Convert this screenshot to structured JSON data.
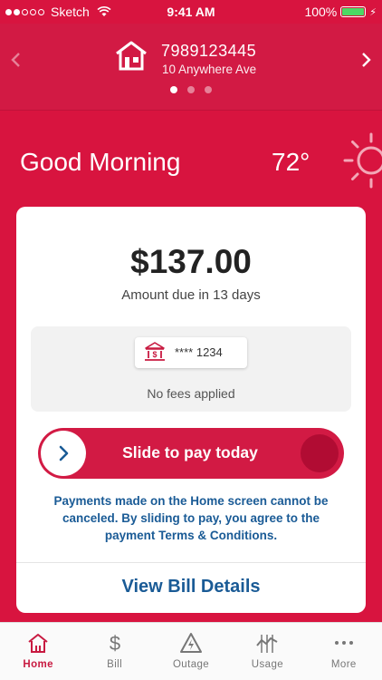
{
  "status_bar": {
    "carrier": "Sketch",
    "time": "9:41 AM",
    "battery": "100%"
  },
  "account": {
    "number": "7989123445",
    "address": "10 Anywhere Ave",
    "pages": 3,
    "active_page": 1
  },
  "greeting": {
    "text": "Good Morning",
    "temperature": "72°",
    "weather_icon": "sun-icon"
  },
  "bill": {
    "amount": "$137.00",
    "due_text": "Amount due in 13 days",
    "payment_method": "**** 1234",
    "fees_text": "No fees applied",
    "slider_label": "Slide to pay today",
    "disclaimer": "Payments made on the Home screen cannot be canceled. By sliding to pay, you agree to the payment Terms & Conditions.",
    "view_details": "View Bill Details"
  },
  "tabs": [
    {
      "label": "Home",
      "icon": "home-icon",
      "active": true
    },
    {
      "label": "Bill",
      "icon": "dollar-icon",
      "active": false
    },
    {
      "label": "Outage",
      "icon": "warning-icon",
      "active": false
    },
    {
      "label": "Usage",
      "icon": "usage-icon",
      "active": false
    },
    {
      "label": "More",
      "icon": "more-icon",
      "active": false
    }
  ],
  "colors": {
    "brand_red": "#d8143f",
    "link_blue": "#1a5b96",
    "battery_green": "#4cd964"
  }
}
